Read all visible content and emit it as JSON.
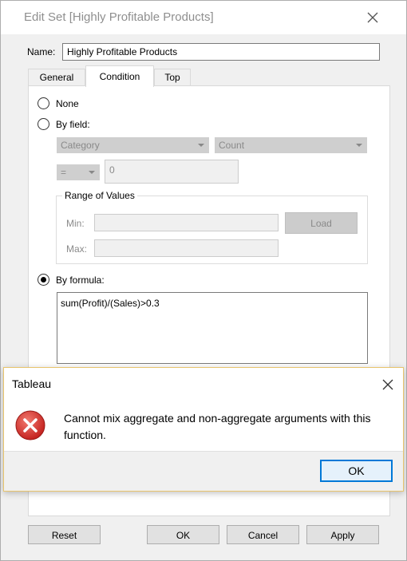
{
  "dialog": {
    "title": "Edit Set [Highly Profitable Products]"
  },
  "name_field": {
    "label": "Name:",
    "value": "Highly Profitable Products"
  },
  "tabs": [
    {
      "label": "General",
      "active": false
    },
    {
      "label": "Condition",
      "active": true
    },
    {
      "label": "Top",
      "active": false
    }
  ],
  "condition": {
    "none_label": "None",
    "by_field_label": "By field:",
    "field_select": "Category",
    "aggregation_select": "Count",
    "operator_select": "=",
    "value_input": "0",
    "range": {
      "title": "Range of Values",
      "min_label": "Min:",
      "max_label": "Max:",
      "load_label": "Load"
    },
    "by_formula_label": "By formula:",
    "selected": "by_formula",
    "formula": "sum(Profit)/(Sales)>0.3"
  },
  "buttons": {
    "reset": "Reset",
    "ok": "OK",
    "cancel": "Cancel",
    "apply": "Apply"
  },
  "error_popup": {
    "title": "Tableau",
    "message": "Cannot mix aggregate and non-aggregate arguments with this function.",
    "ok_label": "OK",
    "icon_color": "#d9322f"
  }
}
